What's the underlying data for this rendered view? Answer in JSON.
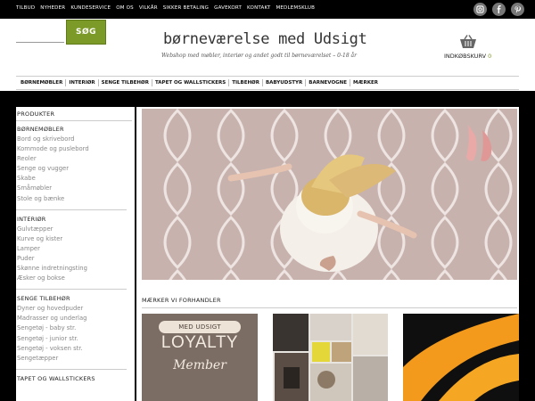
{
  "topnav": [
    "TILBUD",
    "NYHEDER",
    "KUNDESERVICE",
    "OM OS",
    "VILKÅR",
    "SIKKER BETALING",
    "GAVEKORT",
    "KONTAKT",
    "MEDLEMSKLUB"
  ],
  "social": [
    "instagram-icon",
    "facebook-icon",
    "pinterest-icon"
  ],
  "search": {
    "placeholder": "",
    "button_label": "SØG"
  },
  "logo": {
    "title": "børneværelse med Udsigt",
    "tagline": "Webshop med møbler, interiør og andet godt til børneværelset – 0-18 år"
  },
  "basket": {
    "label": "INDKØBSKURV",
    "count": "0"
  },
  "catnav": [
    "BØRNEMØBLER",
    "INTERIØR",
    "SENGE TILBEHØR",
    "TAPET OG WALLSTICKERS",
    "TILBEHØR",
    "BABYUDSTYR",
    "BARNEVOGNE",
    "MÆRKER"
  ],
  "sidebar": {
    "heading": "PRODUKTER",
    "groups": [
      {
        "title": "BØRNEMØBLER",
        "links": [
          "Bord og skrivebord",
          "Kommode og puslebord",
          "Reoler",
          "Senge og vugger",
          "Skabe",
          "Småmøbler",
          "Stole og bænke"
        ]
      },
      {
        "title": "INTERIØR",
        "links": [
          "Gulvtæpper",
          "Kurve og kister",
          "Lamper",
          "Puder",
          "Skønne indretningsting",
          "Æsker og bokse"
        ]
      },
      {
        "title": "SENGE TILBEHØR",
        "links": [
          "Dyner og hovedpuder",
          "Madrasser og underlag",
          "Sengetøj - baby str.",
          "Sengetøj - junior str.",
          "Sengetøj - voksen str.",
          "Sengetæpper"
        ]
      },
      {
        "title": "TAPET OG WALLSTICKERS",
        "links": []
      }
    ]
  },
  "slider": {
    "dots": 5,
    "active": 1
  },
  "brands": {
    "heading": "MÆRKER VI FORHANDLER",
    "loyalty": {
      "pill": "MED UDSIGT",
      "big": "LOYALTY",
      "member": "Member"
    }
  },
  "colors": {
    "accent": "#7c9a28",
    "hero_bg": "#c9b5b2",
    "brand_bg": "#7b6c64"
  }
}
